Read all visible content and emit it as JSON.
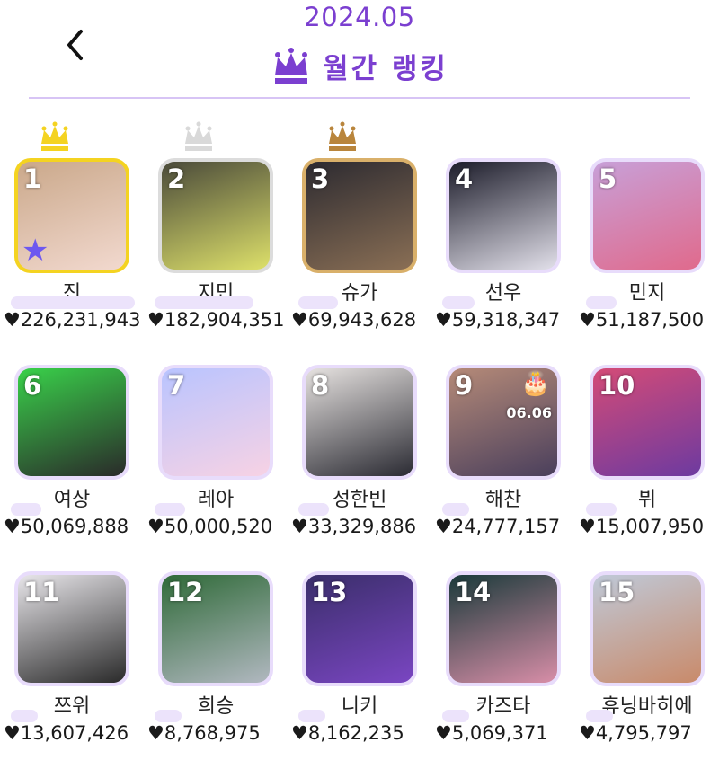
{
  "header": {
    "date": "2024.05",
    "title": "월간 랭킹"
  },
  "colors": {
    "accent": "#7b3fd0",
    "gold": "#f4d321",
    "silver": "#dcdcdc",
    "bronze": "#d9b06a"
  },
  "rankings": [
    {
      "rank": "1",
      "name": "진",
      "score": "226,231,943",
      "frame": "gold",
      "badge": "star-icon"
    },
    {
      "rank": "2",
      "name": "지민",
      "score": "182,904,351",
      "frame": "silver"
    },
    {
      "rank": "3",
      "name": "슈가",
      "score": "69,943,628",
      "frame": "bronze"
    },
    {
      "rank": "4",
      "name": "선우",
      "score": "59,318,347"
    },
    {
      "rank": "5",
      "name": "민지",
      "score": "51,187,500"
    },
    {
      "rank": "6",
      "name": "여상",
      "score": "50,069,888"
    },
    {
      "rank": "7",
      "name": "레아",
      "score": "50,000,520"
    },
    {
      "rank": "8",
      "name": "성한빈",
      "score": "33,329,886"
    },
    {
      "rank": "9",
      "name": "해찬",
      "score": "24,777,157",
      "badge": "birthday-cake-icon",
      "badge_text": "06.06"
    },
    {
      "rank": "10",
      "name": "뷔",
      "score": "15,007,950"
    },
    {
      "rank": "11",
      "name": "쯔위",
      "score": "13,607,426"
    },
    {
      "rank": "12",
      "name": "희승",
      "score": "8,768,975"
    },
    {
      "rank": "13",
      "name": "니키",
      "score": "8,162,235"
    },
    {
      "rank": "14",
      "name": "카즈타",
      "score": "5,069,371"
    },
    {
      "rank": "15",
      "name": "휴닝바히에",
      "score": "4,795,797"
    }
  ]
}
